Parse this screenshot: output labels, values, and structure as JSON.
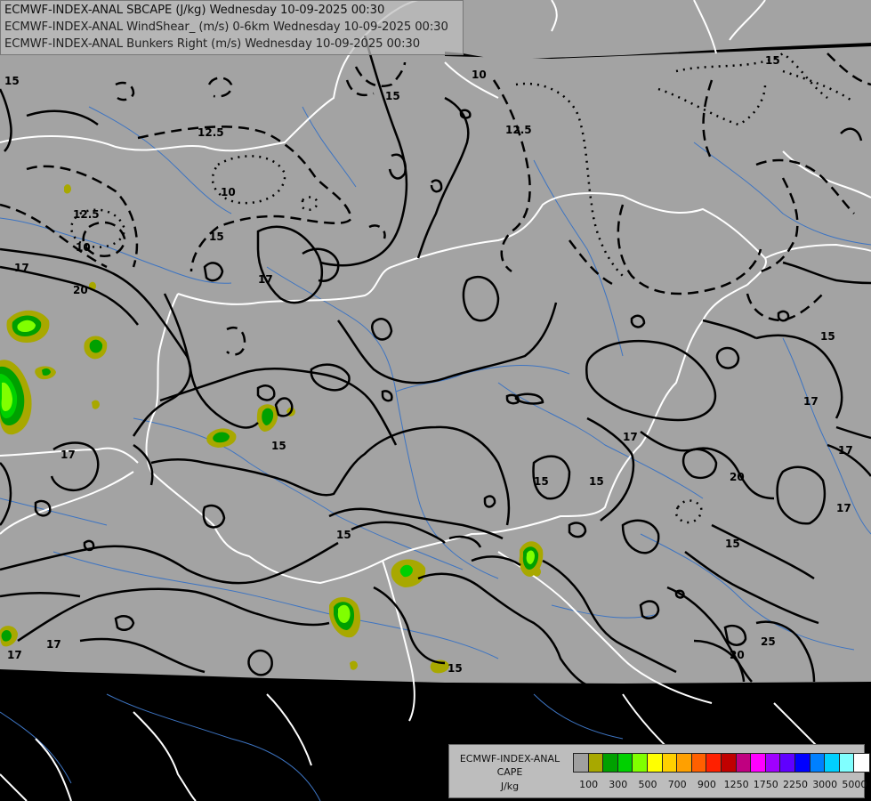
{
  "titles": [
    {
      "name": "ECMWF-INDEX-ANAL",
      "rest": "SBCAPE (J/kg) Wednesday 10-09-2025 00:30"
    },
    {
      "name": "ECMWF-INDEX-ANAL",
      "rest": "WindShear_ (m/s) 0-6km Wednesday 10-09-2025 00:30"
    },
    {
      "name": "ECMWF-INDEX-ANAL",
      "rest": "Bunkers Right (m/s) Wednesday 10-09-2025 00:30"
    }
  ],
  "legend": {
    "line1": "ECMWF-INDEX-ANAL",
    "line2": "CAPE",
    "line3": "J/kg",
    "colors": [
      "#a0a0a0",
      "#a8a800",
      "#00a000",
      "#00d000",
      "#80ff00",
      "#ffff00",
      "#ffd000",
      "#ffa000",
      "#ff6000",
      "#ff2000",
      "#c00000",
      "#c00080",
      "#ff00ff",
      "#a000ff",
      "#6000ff",
      "#0000ff",
      "#0080ff",
      "#00d0ff",
      "#80ffff",
      "#ffffff"
    ],
    "tick_labels": [
      "100",
      "300",
      "500",
      "700",
      "900",
      "1250",
      "1750",
      "2250",
      "3000",
      "5000"
    ]
  },
  "contour_labels": [
    "10",
    "12.5",
    "15",
    "17",
    "20",
    "25"
  ],
  "map_colors": {
    "domain": "#a3a3a3",
    "outside": "#000000",
    "borders": "#ffffff",
    "rivers": "#3a6fb5"
  }
}
